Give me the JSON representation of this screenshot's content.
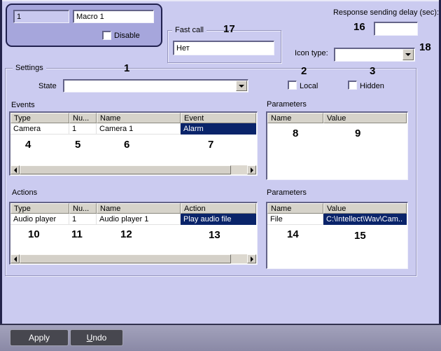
{
  "window": {
    "number_value": "1",
    "name_value": "Macro 1",
    "disable_label": "Disable",
    "response_delay_label": "Response sending delay (sec):",
    "response_delay_value": "",
    "fast_call_label": "Fast call",
    "fast_call_value": "Нет",
    "icon_type_label": "Icon type:",
    "icon_type_value": ""
  },
  "settings": {
    "label": "Settings",
    "state_label": "State",
    "state_value": "",
    "local_label": "Local",
    "hidden_label": "Hidden",
    "events": {
      "label": "Events",
      "columns": [
        "Type",
        "Nu...",
        "Name",
        "Event"
      ],
      "rows": [
        {
          "type": "Camera",
          "number": "1",
          "name": "Camera 1",
          "event": "Alarm"
        }
      ]
    },
    "event_parameters": {
      "label": "Parameters",
      "columns": [
        "Name",
        "Value"
      ],
      "rows": []
    },
    "actions": {
      "label": "Actions",
      "columns": [
        "Type",
        "Nu...",
        "Name",
        "Action"
      ],
      "rows": [
        {
          "type": "Audio player",
          "number": "1",
          "name": "Audio player 1",
          "action": "Play audio file"
        }
      ]
    },
    "action_parameters": {
      "label": "Parameters",
      "columns": [
        "Name",
        "Value"
      ],
      "rows": [
        {
          "name": "File",
          "value": "C:\\Intellect\\Wav\\Cam.."
        }
      ]
    }
  },
  "footer": {
    "apply_label": "Apply",
    "undo_first": "U",
    "undo_rest": "ndo"
  },
  "annotations": {
    "n1": "1",
    "n2": "2",
    "n3": "3",
    "n4": "4",
    "n5": "5",
    "n6": "6",
    "n7": "7",
    "n8": "8",
    "n9": "9",
    "n10": "10",
    "n11": "11",
    "n12": "12",
    "n13": "13",
    "n14": "14",
    "n15": "15",
    "n16": "16",
    "n17": "17",
    "n18": "18"
  },
  "colors": {
    "background": "#cbcbf0",
    "panel": "#a6a6dc",
    "selection": "#0a246a",
    "footer_button": "#47474f",
    "header_gray": "#d6d3ca"
  }
}
